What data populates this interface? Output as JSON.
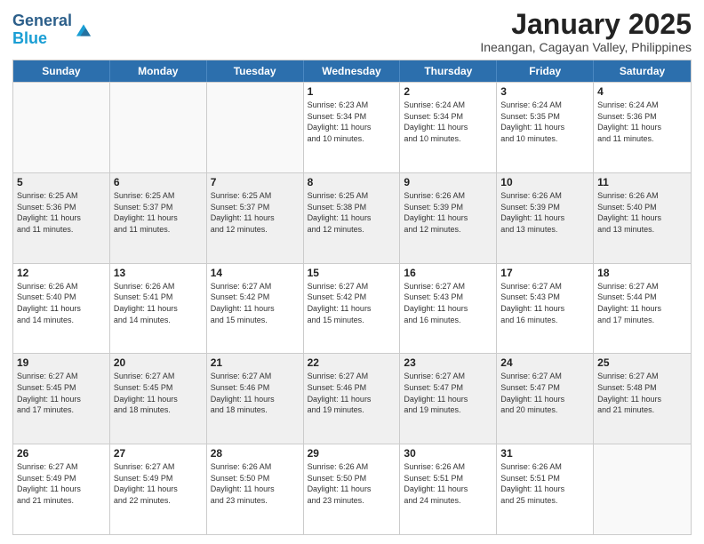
{
  "header": {
    "logo_line1": "General",
    "logo_line2": "Blue",
    "month": "January 2025",
    "location": "Ineangan, Cagayan Valley, Philippines"
  },
  "weekdays": [
    "Sunday",
    "Monday",
    "Tuesday",
    "Wednesday",
    "Thursday",
    "Friday",
    "Saturday"
  ],
  "rows": [
    [
      {
        "day": "",
        "info": ""
      },
      {
        "day": "",
        "info": ""
      },
      {
        "day": "",
        "info": ""
      },
      {
        "day": "1",
        "info": "Sunrise: 6:23 AM\nSunset: 5:34 PM\nDaylight: 11 hours\nand 10 minutes."
      },
      {
        "day": "2",
        "info": "Sunrise: 6:24 AM\nSunset: 5:34 PM\nDaylight: 11 hours\nand 10 minutes."
      },
      {
        "day": "3",
        "info": "Sunrise: 6:24 AM\nSunset: 5:35 PM\nDaylight: 11 hours\nand 10 minutes."
      },
      {
        "day": "4",
        "info": "Sunrise: 6:24 AM\nSunset: 5:36 PM\nDaylight: 11 hours\nand 11 minutes."
      }
    ],
    [
      {
        "day": "5",
        "info": "Sunrise: 6:25 AM\nSunset: 5:36 PM\nDaylight: 11 hours\nand 11 minutes."
      },
      {
        "day": "6",
        "info": "Sunrise: 6:25 AM\nSunset: 5:37 PM\nDaylight: 11 hours\nand 11 minutes."
      },
      {
        "day": "7",
        "info": "Sunrise: 6:25 AM\nSunset: 5:37 PM\nDaylight: 11 hours\nand 12 minutes."
      },
      {
        "day": "8",
        "info": "Sunrise: 6:25 AM\nSunset: 5:38 PM\nDaylight: 11 hours\nand 12 minutes."
      },
      {
        "day": "9",
        "info": "Sunrise: 6:26 AM\nSunset: 5:39 PM\nDaylight: 11 hours\nand 12 minutes."
      },
      {
        "day": "10",
        "info": "Sunrise: 6:26 AM\nSunset: 5:39 PM\nDaylight: 11 hours\nand 13 minutes."
      },
      {
        "day": "11",
        "info": "Sunrise: 6:26 AM\nSunset: 5:40 PM\nDaylight: 11 hours\nand 13 minutes."
      }
    ],
    [
      {
        "day": "12",
        "info": "Sunrise: 6:26 AM\nSunset: 5:40 PM\nDaylight: 11 hours\nand 14 minutes."
      },
      {
        "day": "13",
        "info": "Sunrise: 6:26 AM\nSunset: 5:41 PM\nDaylight: 11 hours\nand 14 minutes."
      },
      {
        "day": "14",
        "info": "Sunrise: 6:27 AM\nSunset: 5:42 PM\nDaylight: 11 hours\nand 15 minutes."
      },
      {
        "day": "15",
        "info": "Sunrise: 6:27 AM\nSunset: 5:42 PM\nDaylight: 11 hours\nand 15 minutes."
      },
      {
        "day": "16",
        "info": "Sunrise: 6:27 AM\nSunset: 5:43 PM\nDaylight: 11 hours\nand 16 minutes."
      },
      {
        "day": "17",
        "info": "Sunrise: 6:27 AM\nSunset: 5:43 PM\nDaylight: 11 hours\nand 16 minutes."
      },
      {
        "day": "18",
        "info": "Sunrise: 6:27 AM\nSunset: 5:44 PM\nDaylight: 11 hours\nand 17 minutes."
      }
    ],
    [
      {
        "day": "19",
        "info": "Sunrise: 6:27 AM\nSunset: 5:45 PM\nDaylight: 11 hours\nand 17 minutes."
      },
      {
        "day": "20",
        "info": "Sunrise: 6:27 AM\nSunset: 5:45 PM\nDaylight: 11 hours\nand 18 minutes."
      },
      {
        "day": "21",
        "info": "Sunrise: 6:27 AM\nSunset: 5:46 PM\nDaylight: 11 hours\nand 18 minutes."
      },
      {
        "day": "22",
        "info": "Sunrise: 6:27 AM\nSunset: 5:46 PM\nDaylight: 11 hours\nand 19 minutes."
      },
      {
        "day": "23",
        "info": "Sunrise: 6:27 AM\nSunset: 5:47 PM\nDaylight: 11 hours\nand 19 minutes."
      },
      {
        "day": "24",
        "info": "Sunrise: 6:27 AM\nSunset: 5:47 PM\nDaylight: 11 hours\nand 20 minutes."
      },
      {
        "day": "25",
        "info": "Sunrise: 6:27 AM\nSunset: 5:48 PM\nDaylight: 11 hours\nand 21 minutes."
      }
    ],
    [
      {
        "day": "26",
        "info": "Sunrise: 6:27 AM\nSunset: 5:49 PM\nDaylight: 11 hours\nand 21 minutes."
      },
      {
        "day": "27",
        "info": "Sunrise: 6:27 AM\nSunset: 5:49 PM\nDaylight: 11 hours\nand 22 minutes."
      },
      {
        "day": "28",
        "info": "Sunrise: 6:26 AM\nSunset: 5:50 PM\nDaylight: 11 hours\nand 23 minutes."
      },
      {
        "day": "29",
        "info": "Sunrise: 6:26 AM\nSunset: 5:50 PM\nDaylight: 11 hours\nand 23 minutes."
      },
      {
        "day": "30",
        "info": "Sunrise: 6:26 AM\nSunset: 5:51 PM\nDaylight: 11 hours\nand 24 minutes."
      },
      {
        "day": "31",
        "info": "Sunrise: 6:26 AM\nSunset: 5:51 PM\nDaylight: 11 hours\nand 25 minutes."
      },
      {
        "day": "",
        "info": ""
      }
    ]
  ]
}
